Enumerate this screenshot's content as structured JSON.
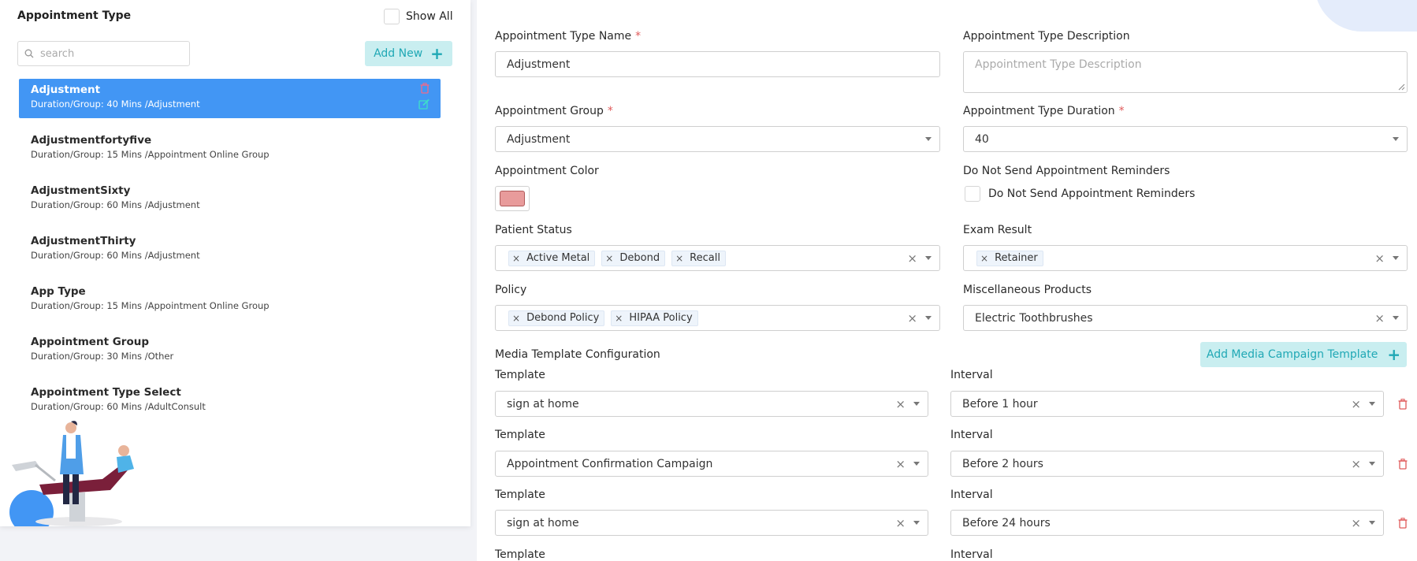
{
  "left": {
    "title": "Appointment Type",
    "show_all_label": "Show All",
    "search_placeholder": "search",
    "add_new_label": "Add New",
    "items": [
      {
        "name": "Adjustment",
        "sub": "Duration/Group: 40 Mins /Adjustment"
      },
      {
        "name": "Adjustmentfortyfive",
        "sub": "Duration/Group: 15 Mins /Appointment Online Group"
      },
      {
        "name": "AdjustmentSixty",
        "sub": "Duration/Group: 60 Mins /Adjustment"
      },
      {
        "name": "AdjustmentThirty",
        "sub": "Duration/Group: 60 Mins /Adjustment"
      },
      {
        "name": "App Type",
        "sub": "Duration/Group: 15 Mins /Appointment Online Group"
      },
      {
        "name": "Appointment Group",
        "sub": "Duration/Group: 30 Mins /Other"
      },
      {
        "name": "Appointment Type Select",
        "sub": "Duration/Group: 60 Mins /AdultConsult"
      }
    ]
  },
  "form": {
    "name_label": "Appointment Type Name",
    "name_value": "Adjustment",
    "description_label": "Appointment Type Description",
    "description_placeholder": "Appointment Type Description",
    "group_label": "Appointment Group",
    "group_value": "Adjustment",
    "duration_label": "Appointment Type Duration",
    "duration_value": "40",
    "color_label": "Appointment Color",
    "color_value": "#e89b9b",
    "reminders_label": "Do Not Send Appointment Reminders",
    "reminders_checkbox_label": "Do Not Send Appointment Reminders",
    "patient_status_label": "Patient Status",
    "patient_status_chips": [
      "Active Metal",
      "Debond",
      "Recall"
    ],
    "exam_result_label": "Exam Result",
    "exam_result_chips": [
      "Retainer"
    ],
    "policy_label": "Policy",
    "policy_chips": [
      "Debond Policy",
      "HIPAA Policy"
    ],
    "misc_label": "Miscellaneous Products",
    "misc_value": "Electric Toothbrushes",
    "required_mark": "*"
  },
  "media": {
    "section_title": "Media Template Configuration",
    "add_label": "Add Media Campaign Template",
    "template_label": "Template",
    "interval_label": "Interval",
    "rows": [
      {
        "template": "sign at home",
        "interval": "Before 1 hour"
      },
      {
        "template": "Appointment Confirmation Campaign",
        "interval": "Before 2 hours"
      },
      {
        "template": "sign at home",
        "interval": "Before 24 hours"
      }
    ]
  },
  "colors": {
    "accent": "#4296f4",
    "teal": "#20a8b5",
    "danger": "#e05a5a"
  }
}
